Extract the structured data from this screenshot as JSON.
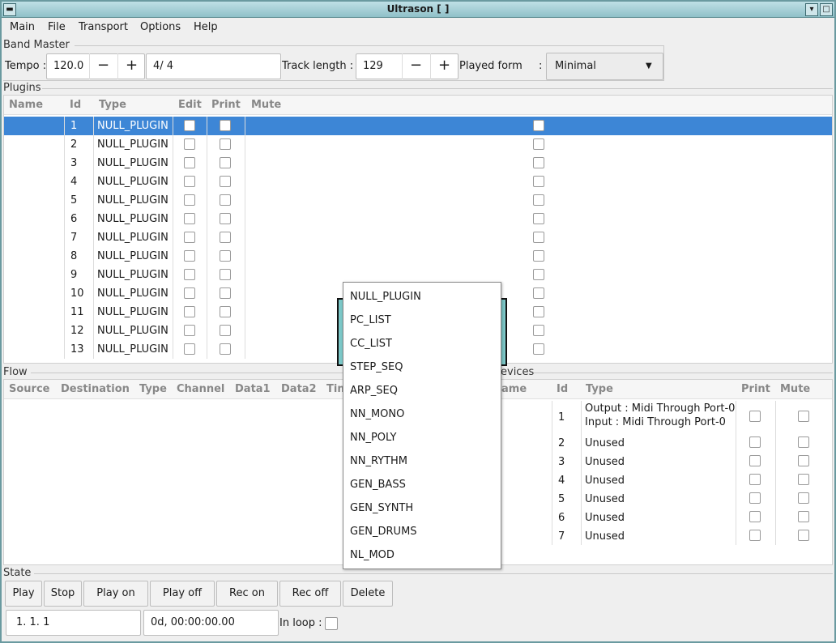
{
  "window": {
    "title": "Ultrason [ ]"
  },
  "menu": [
    "Main",
    "File",
    "Transport",
    "Options",
    "Help"
  ],
  "band_master": {
    "label": "Band Master",
    "tempo_label": "Tempo :",
    "tempo_value": "120.0",
    "minus": "−",
    "plus": "+",
    "signature": "4/ 4",
    "track_length_label": "Track length :",
    "track_length_value": "129",
    "played_form_label": "Played form",
    "played_form_colon": ":",
    "played_form_value": "Minimal"
  },
  "plugins": {
    "label": "Plugins",
    "headers": [
      "Name",
      "Id",
      "Type",
      "Edit",
      "Print",
      "Mute"
    ],
    "rows": [
      {
        "id": "1",
        "type": "NULL_PLUGIN",
        "selected": true
      },
      {
        "id": "2",
        "type": "NULL_PLUGIN"
      },
      {
        "id": "3",
        "type": "NULL_PLUGIN"
      },
      {
        "id": "4",
        "type": "NULL_PLUGIN"
      },
      {
        "id": "5",
        "type": "NULL_PLUGIN"
      },
      {
        "id": "6",
        "type": "NULL_PLUGIN"
      },
      {
        "id": "7",
        "type": "NULL_PLUGIN"
      },
      {
        "id": "8",
        "type": "NULL_PLUGIN"
      },
      {
        "id": "9",
        "type": "NULL_PLUGIN"
      },
      {
        "id": "10",
        "type": "NULL_PLUGIN"
      },
      {
        "id": "11",
        "type": "NULL_PLUGIN"
      },
      {
        "id": "12",
        "type": "NULL_PLUGIN"
      },
      {
        "id": "13",
        "type": "NULL_PLUGIN"
      }
    ]
  },
  "flow": {
    "label": "Flow",
    "headers": [
      "Source",
      "Destination",
      "Type",
      "Channel",
      "Data1",
      "Data2",
      "Tim"
    ]
  },
  "devices": {
    "label": "evices",
    "headers": [
      "ame",
      "Id",
      "Type",
      "Print",
      "Mute"
    ],
    "rows": [
      {
        "id": "1",
        "type_line1": "Output : Midi Through Port-0",
        "type_line2": "Input : Midi Through Port-0"
      },
      {
        "id": "2",
        "type": "Unused"
      },
      {
        "id": "3",
        "type": "Unused"
      },
      {
        "id": "4",
        "type": "Unused"
      },
      {
        "id": "5",
        "type": "Unused"
      },
      {
        "id": "6",
        "type": "Unused"
      },
      {
        "id": "7",
        "type": "Unused"
      }
    ]
  },
  "popup": {
    "items": [
      "NULL_PLUGIN",
      "PC_LIST",
      "CC_LIST",
      "STEP_SEQ",
      "ARP_SEQ",
      "NN_MONO",
      "NN_POLY",
      "NN_RYTHM",
      "GEN_BASS",
      "GEN_SYNTH",
      "GEN_DRUMS",
      "NL_MOD"
    ]
  },
  "state": {
    "label": "State",
    "buttons": [
      "Play",
      "Stop",
      "Play on",
      "Play off",
      "Rec on",
      "Rec off",
      "Delete"
    ],
    "position": "1. 1. 1",
    "time": "0d, 00:00:00.00",
    "in_loop_label": "In loop :"
  }
}
